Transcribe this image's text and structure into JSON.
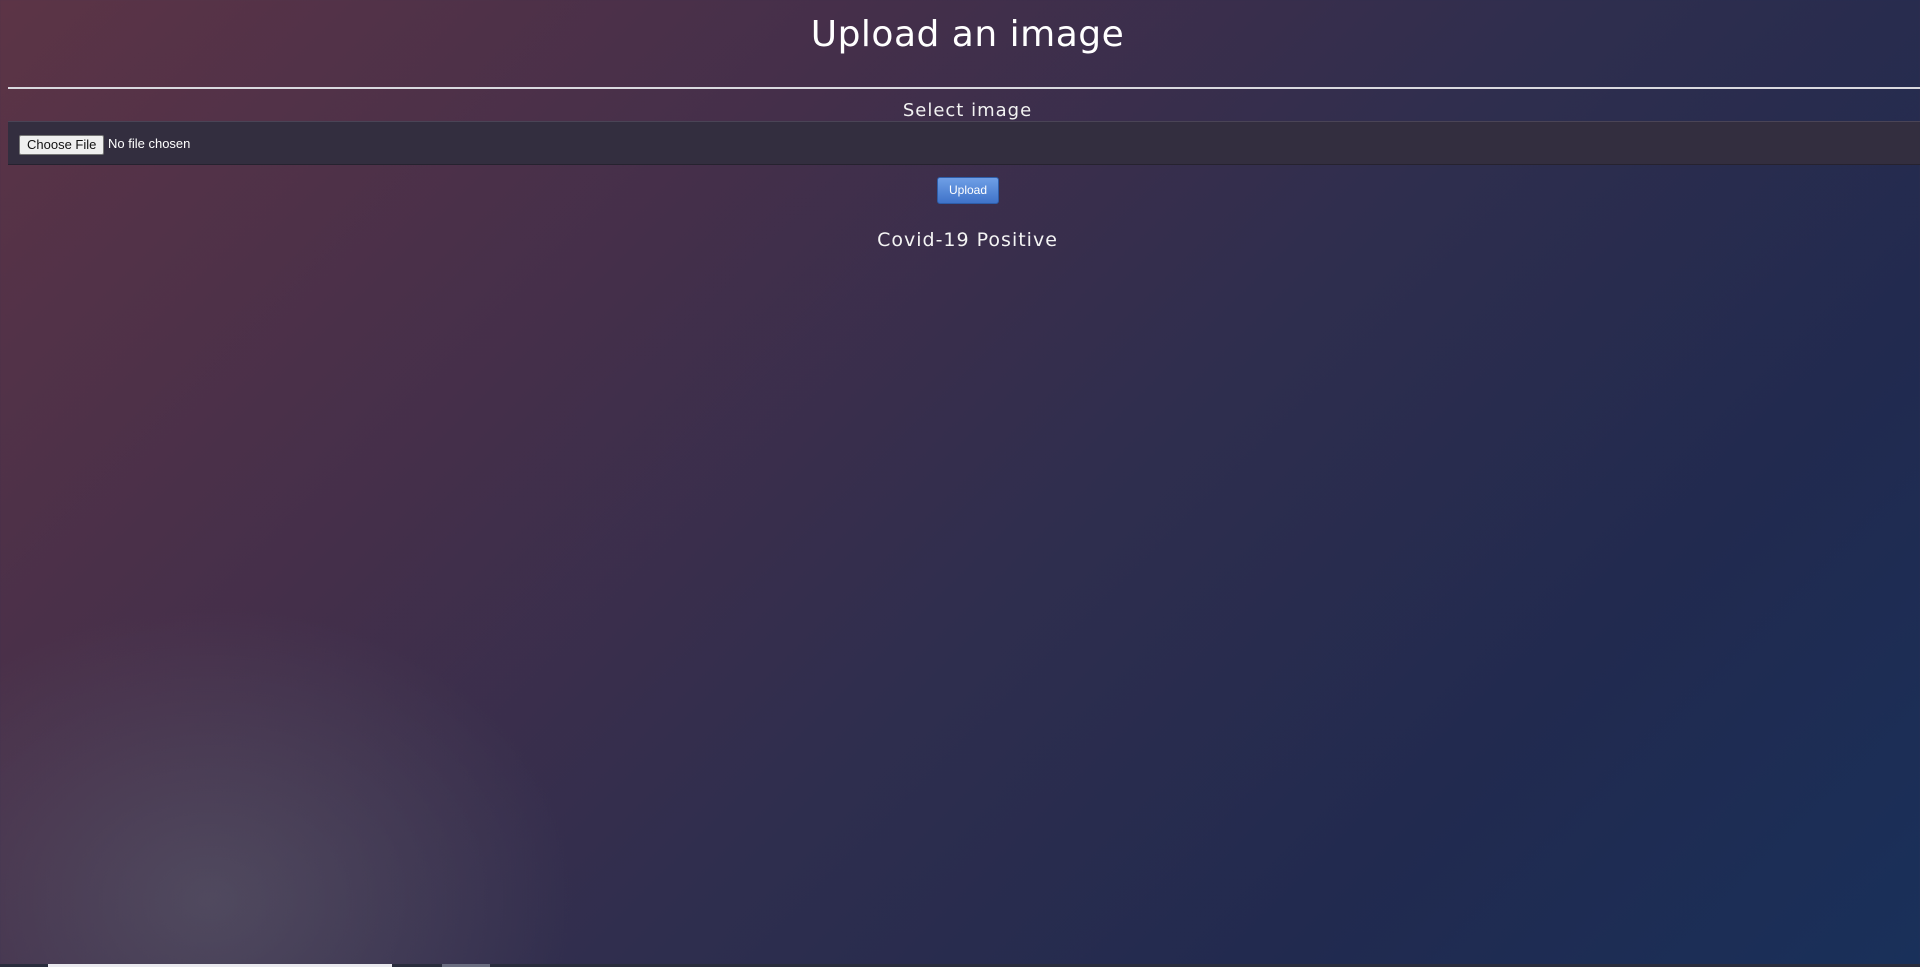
{
  "header": {
    "title": "Upload an image"
  },
  "form": {
    "select_label": "Select image",
    "file_input": {
      "button_label": "Choose File",
      "status_text": "No file chosen"
    },
    "upload_label": "Upload"
  },
  "result": {
    "text": "Covid-19 Positive"
  },
  "colors": {
    "upload_button": "#4a7fd6",
    "file_row_background": "#332e3f"
  }
}
